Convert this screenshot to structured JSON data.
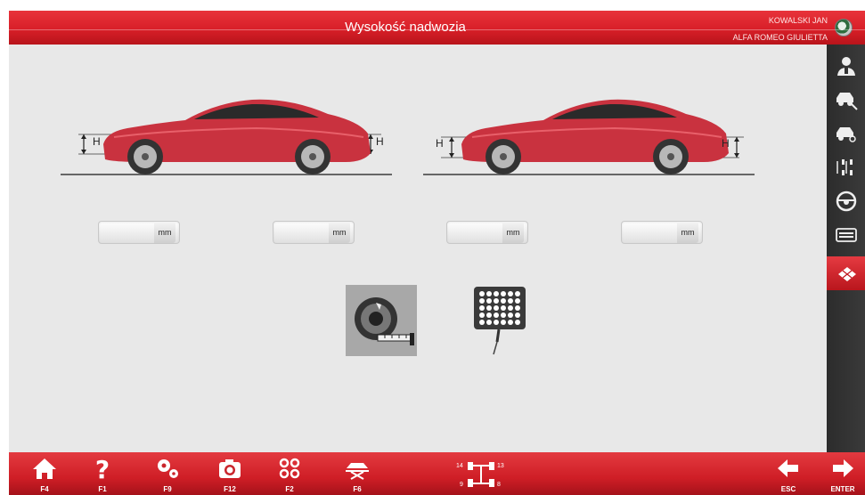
{
  "header": {
    "title": "Wysokość nadwozia",
    "user": "KOWALSKI JAN",
    "vehicle": "ALFA ROMEO GIULIETTA",
    "logo_icon": "alfa-romeo-logo-icon"
  },
  "colors": {
    "brand_red": "#d81f28",
    "content_bg": "#e8e8e8",
    "sidebar_bg": "#333333",
    "car_red": "#c9323f"
  },
  "diagrams": {
    "height_marker": "H"
  },
  "fields": [
    {
      "unit": "mm",
      "value": ""
    },
    {
      "unit": "mm",
      "value": ""
    },
    {
      "unit": "mm",
      "value": ""
    },
    {
      "unit": "mm",
      "value": ""
    }
  ],
  "tools": {
    "tape_icon": "measuring-tape-icon",
    "target_icon": "target-board-icon"
  },
  "sidebar": {
    "items": [
      {
        "icon": "operator-icon"
      },
      {
        "icon": "car-service-icon"
      },
      {
        "icon": "car-search-icon"
      },
      {
        "icon": "axle-measure-icon"
      },
      {
        "icon": "steering-wheel-icon"
      },
      {
        "icon": "keyboard-icon"
      },
      {
        "icon": "target-grid-icon",
        "active": true
      }
    ]
  },
  "footer": {
    "buttons": [
      {
        "key": "F4",
        "icon": "home-icon"
      },
      {
        "key": "F1",
        "icon": "help-icon"
      },
      {
        "key": "F9",
        "icon": "settings-icon"
      },
      {
        "key": "F12",
        "icon": "camera-icon"
      },
      {
        "key": "F2",
        "icon": "command-icon"
      },
      {
        "key": "F6",
        "icon": "car-lift-icon"
      },
      {
        "key": "ESC",
        "icon": "back-arrow-icon"
      },
      {
        "key": "ENTER",
        "icon": "forward-arrow-icon"
      }
    ],
    "axle_labels": {
      "top_left": "14",
      "top_right": "13",
      "bottom_left": "9",
      "bottom_right": "8"
    }
  }
}
